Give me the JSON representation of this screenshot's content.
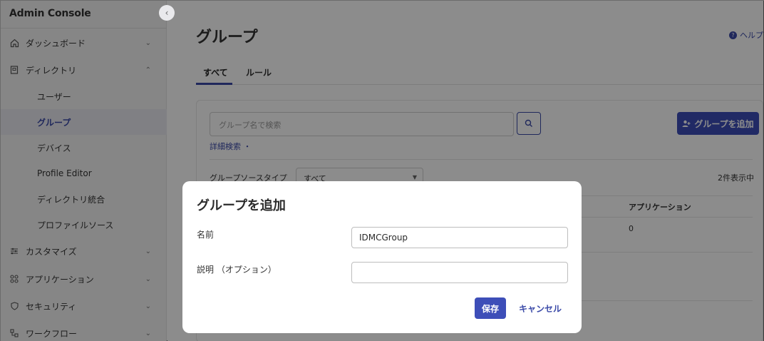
{
  "app": {
    "title": "Admin Console"
  },
  "sidebar": {
    "items": [
      {
        "label": "ダッシュボード",
        "icon": "home-icon"
      },
      {
        "label": "ディレクトリ",
        "icon": "directory-icon"
      },
      {
        "label": "カスタマイズ",
        "icon": "sliders-icon"
      },
      {
        "label": "アプリケーション",
        "icon": "apps-icon"
      },
      {
        "label": "セキュリティ",
        "icon": "shield-icon"
      },
      {
        "label": "ワークフロー",
        "icon": "workflow-icon"
      }
    ],
    "directory_sub": [
      "ユーザー",
      "グループ",
      "デバイス",
      "Profile Editor",
      "ディレクトリ統合",
      "プロファイルソース"
    ]
  },
  "main": {
    "title": "グループ",
    "help_label": "ヘルプ",
    "tabs": [
      {
        "label": "すべて"
      },
      {
        "label": "ルール"
      }
    ],
    "search_placeholder": "グループ名で検索",
    "add_group_label": "グループを追加",
    "advanced_search": "詳細検索 ・",
    "filter_label": "グループソースタイプ",
    "filter_value": "すべて",
    "count_text": "2件表示中",
    "columns": [
      "アプリケーション"
    ],
    "row_values": [
      "0"
    ]
  },
  "modal": {
    "title": "グループを追加",
    "name_label": "名前",
    "name_value": "IDMCGroup",
    "desc_label": "説明 （オプション）",
    "desc_value": "",
    "save_label": "保存",
    "cancel_label": "キャンセル"
  },
  "colors": {
    "primary": "#3d4eb8",
    "overlay": "#000000"
  }
}
